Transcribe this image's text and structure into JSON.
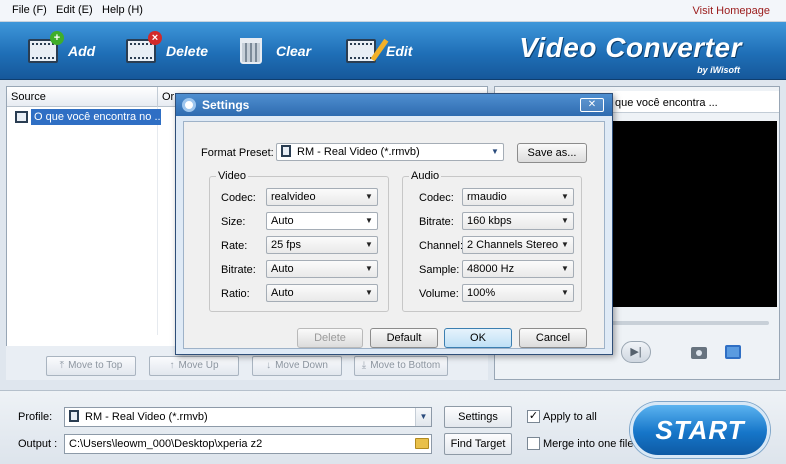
{
  "menu": {
    "file": "File (F)",
    "edit": "Edit (E)",
    "help": "Help (H)",
    "visit": "Visit Homepage"
  },
  "toolbar": {
    "add": "Add",
    "delete": "Delete",
    "clear": "Clear",
    "edit": "Edit",
    "brand": "Video Converter",
    "brand_sub": "by iWisoft"
  },
  "list": {
    "col_source": "Source",
    "col_or": "Or",
    "file_name": "O que você encontra no ..."
  },
  "list_buttons": {
    "move_top": "Move to Top",
    "move_up": "Move Up",
    "move_down": "Move Down",
    "move_bottom": "Move to Bottom"
  },
  "preview": {
    "title": "que você encontra ..."
  },
  "bottom": {
    "profile_label": "Profile:",
    "profile_value": "RM - Real Video (*.rmvb)",
    "settings_btn": "Settings",
    "apply_all": "Apply to all",
    "apply_all_checked": true,
    "output_label": "Output :",
    "output_value": "C:\\Users\\leowm_000\\Desktop\\xperia z2",
    "find_target": "Find Target",
    "merge": "Merge into one file",
    "merge_checked": false,
    "start": "START"
  },
  "dialog": {
    "title": "Settings",
    "close": "✕",
    "format_preset_label": "Format Preset:",
    "format_preset_value": "RM - Real Video (*.rmvb)",
    "save_as": "Save as...",
    "video": {
      "group": "Video",
      "codec_label": "Codec:",
      "codec": "realvideo",
      "size_label": "Size:",
      "size": "Auto",
      "rate_label": "Rate:",
      "rate": "25 fps",
      "bitrate_label": "Bitrate:",
      "bitrate": "Auto",
      "ratio_label": "Ratio:",
      "ratio": "Auto"
    },
    "audio": {
      "group": "Audio",
      "codec_label": "Codec:",
      "codec": "rmaudio",
      "bitrate_label": "Bitrate:",
      "bitrate": "160 kbps",
      "channel_label": "Channel:",
      "channel": "2 Channels Stereo",
      "sample_label": "Sample:",
      "sample": "48000 Hz",
      "volume_label": "Volume:",
      "volume": "100%"
    },
    "buttons": {
      "delete": "Delete",
      "default": "Default",
      "ok": "OK",
      "cancel": "Cancel"
    }
  }
}
